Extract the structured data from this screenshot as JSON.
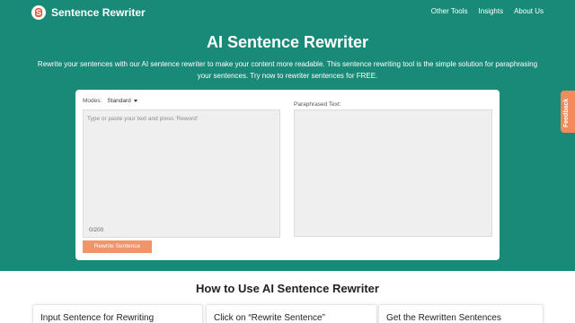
{
  "nav": {
    "brand": "Sentence Rewriter",
    "logo_letter": "S",
    "links": [
      "Other Tools",
      "Insights",
      "About Us"
    ]
  },
  "hero": {
    "title": "AI Sentence Rewriter",
    "subtitle": "Rewrite your sentences with our AI sentence rewriter to make your content more readable. This sentence rewriting tool is the simple solution for paraphrasing your sentences. Try now to rewriter sentences for FREE."
  },
  "tool": {
    "modes_label": "Modes:",
    "mode_selected": "Standard",
    "input_placeholder": "Type or paste your text and press 'Reword'",
    "counter": "0/200",
    "output_label": "Paraphrased Text:",
    "button_label": "Rewrite Sentence"
  },
  "feedback_label": "Feedback",
  "how_to": {
    "title": "How to Use AI Sentence Rewriter",
    "steps": [
      "Input Sentence for Rewriting",
      "Click on “Rewrite Sentence”",
      "Get the Rewritten Sentences"
    ]
  },
  "colors": {
    "hero_bg": "#1a8a78",
    "button": "#f0946a",
    "feedback": "#f28a5b"
  }
}
